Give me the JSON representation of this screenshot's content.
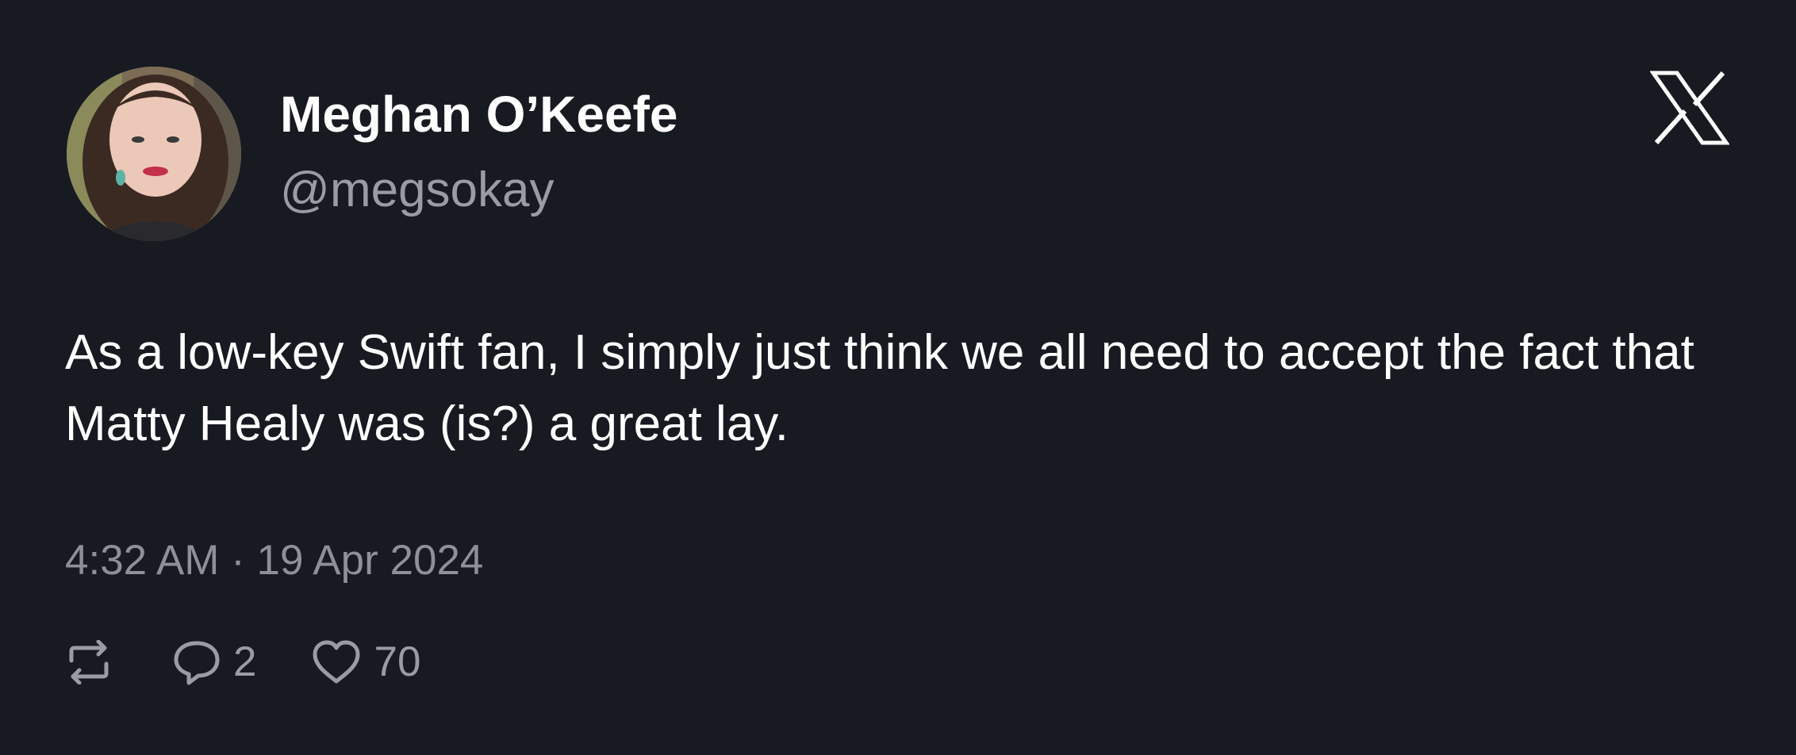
{
  "author": {
    "display_name": "Meghan O’Keefe",
    "handle": "@megsokay",
    "avatar_icon": "profile-photo"
  },
  "brand": {
    "logo_icon": "x-logo-icon"
  },
  "tweet": {
    "text": "As a low-key Swift fan, I simply just think we all need to accept the fact that Matty Healy was (is?) a great lay.",
    "timestamp": "4:32 AM · 19 Apr 2024"
  },
  "actions": {
    "retweet_icon": "retweet-icon",
    "reply_icon": "reply-icon",
    "reply_count": "2",
    "like_icon": "heart-icon",
    "like_count": "70"
  },
  "colors": {
    "background": "#181a22",
    "primary_text": "#ffffff",
    "secondary_text": "#9a9ca3"
  }
}
